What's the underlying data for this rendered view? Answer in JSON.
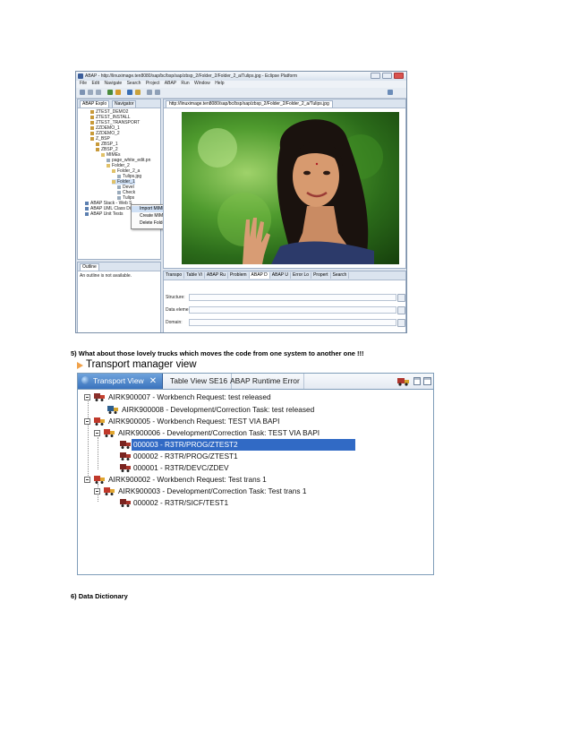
{
  "eclipse": {
    "title": "ABAP - http://linuximage.ten8080/sap/bc/bsp/sap/zbsp_2/Folder_2/Folder_2_a/Tulips.jpg - Eclipse Platform",
    "menu": [
      "File",
      "Edit",
      "Navigate",
      "Search",
      "Project",
      "ABAP",
      "Run",
      "Window",
      "Help"
    ],
    "left_tabs": [
      "ABAP Explo",
      "Navigator"
    ],
    "tree": [
      "ZTEST_DEMO2",
      "ZTEST_INSTALL",
      "ZTEST_TRANSPORT",
      "ZZDEMO_1",
      "ZZDEMO_2",
      "Z_BSP",
      "ZBSP_1",
      "ZBSP_2",
      "MIMEs",
      "page_white_edit.pn",
      "Folder_2",
      "Folder_2_a",
      "Tulips.jpg",
      "Folder_1",
      "Devel",
      "Check",
      "Tulips",
      "ABAP Stack - Web S",
      "ABAP UML Class Diagrams",
      "ABAP Unit Tests"
    ],
    "context_menu": [
      "Import MIME object",
      "Create MIME Folder",
      "Delete Folder"
    ],
    "outline_tab": "Outline",
    "outline_text": "An outline is not available.",
    "editor_tab": "http://linuximage.ten8080/sap/bc/bsp/sap/zbsp_2/Folder_2/Folder_2_a/Tulips.jpg",
    "bottom_tabs": [
      "Transpo",
      "Table Vi",
      "ABAP Ru",
      "Problem",
      "ABAP D",
      "ABAP U",
      "Error Lo",
      "Propert",
      "Search"
    ],
    "fields": [
      "Structure:",
      "Data element:",
      "Domain:"
    ]
  },
  "headings": {
    "h5": "5) What about those lovely trucks which moves the code from one system to another one !!!",
    "h6": "6) Data Dictionary"
  },
  "transport": {
    "view_title": "Transport manager view",
    "tabs": [
      "Transport View",
      "Table View SE16",
      "ABAP Runtime Error"
    ],
    "close_glyph": "✕",
    "rows": [
      {
        "text": "AIRK900007 - Workbench Request: test released"
      },
      {
        "text": "AIRK900008 - Development/Correction Task: test released"
      },
      {
        "text": "AIRK900005 - Workbench Request: TEST VIA BAPI"
      },
      {
        "text": "AIRK900006 - Development/Correction Task: TEST VIA BAPI"
      },
      {
        "text": "000003 - R3TR/PROG/ZTEST2"
      },
      {
        "text": "000002 - R3TR/PROG/ZTEST1"
      },
      {
        "text": "000001 - R3TR/DEVC/ZDEV"
      },
      {
        "text": "AIRK900002 - Workbench Request: Test trans 1"
      },
      {
        "text": "AIRK900003 - Development/Correction Task: Test trans 1"
      },
      {
        "text": "000002 - R3TR/SICF/TEST1"
      }
    ],
    "selected_row": "000003 - R3TR/PROG/ZTEST2"
  },
  "colors": {
    "selection": "#316ac5",
    "tab_active": "#3a73bd",
    "accent_arrow": "#f0a14a"
  }
}
